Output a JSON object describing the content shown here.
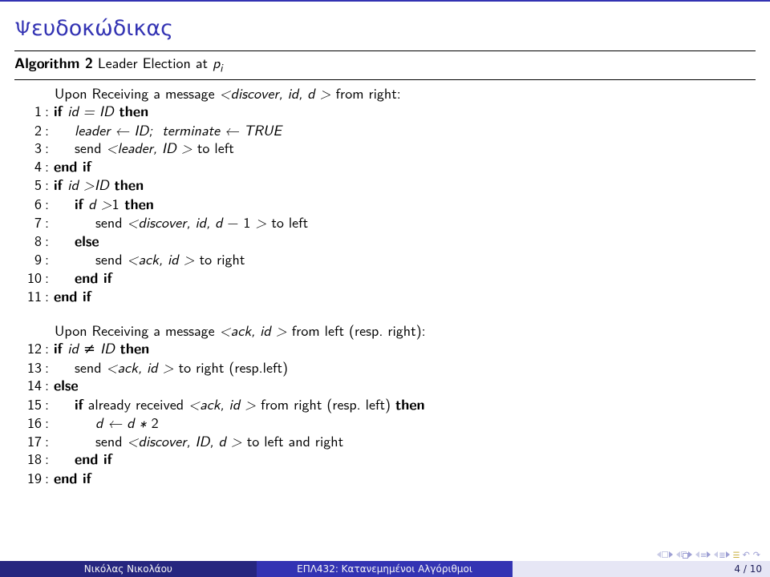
{
  "title": "Ψευδοκώδικας",
  "algorithm": {
    "caption_bold": "Algorithm 2",
    "caption_rest": " Leader Election at ",
    "caption_var": "p",
    "caption_sub": "i"
  },
  "block1": {
    "header_pre": "Upon Receiving a message ",
    "header_it": "<discover, id, d >",
    "header_post": " from right:",
    "l1_n": "1",
    "l1_pre": "if ",
    "l1_it": "id = ID",
    "l1_post": " then",
    "l2_n": "2",
    "l2_it": "leader ← ID;  terminate ← TRUE",
    "l3_n": "3",
    "l3_pre": "send ",
    "l3_it": "<leader, ID >",
    "l3_post": " to left",
    "l4_n": "4",
    "l4": "end if",
    "l5_n": "5",
    "l5_pre": "if ",
    "l5_it": "id >ID",
    "l5_post": " then",
    "l6_n": "6",
    "l6_pre": "if ",
    "l6_it": "d >",
    "l6_num": "1",
    "l6_post": " then",
    "l7_n": "7",
    "l7_pre": "send ",
    "l7_it": "<discover, id, d",
    "l7_mid": " − 1 ",
    "l7_it2": ">",
    "l7_post": " to left",
    "l8_n": "8",
    "l8": "else",
    "l9_n": "9",
    "l9_pre": "send ",
    "l9_it": "<ack, id >",
    "l9_post": " to right",
    "l10_n": "10",
    "l10": "end if",
    "l11_n": "11",
    "l11": "end if"
  },
  "block2": {
    "header_pre": "Upon Receiving a message ",
    "header_it": "<ack, id >",
    "header_post": " from left (resp. right):",
    "l12_n": "12",
    "l12_pre": "if ",
    "l12_it": "id ≠ ID",
    "l12_post": " then",
    "l13_n": "13",
    "l13_pre": "send ",
    "l13_it": "<ack, id >",
    "l13_post": " to right (resp.left)",
    "l14_n": "14",
    "l14": "else",
    "l15_n": "15",
    "l15_pre": "if",
    "l15_mid": " already received ",
    "l15_it": "<ack, id >",
    "l15_post": " from right (resp. left) ",
    "l15_then": "then",
    "l16_n": "16",
    "l16_it": "d ← d ∗ ",
    "l16_num": "2",
    "l17_n": "17",
    "l17_pre": "send ",
    "l17_it": "<discover, ID, d >",
    "l17_post": " to left and right",
    "l18_n": "18",
    "l18": "end if",
    "l19_n": "19",
    "l19": "end if"
  },
  "footer": {
    "left": "Νικόλας Νικολάου",
    "mid": "ΕΠΛ432: Κατανεμημένοι Αλγόριθμοι",
    "right": "4 / 10"
  }
}
